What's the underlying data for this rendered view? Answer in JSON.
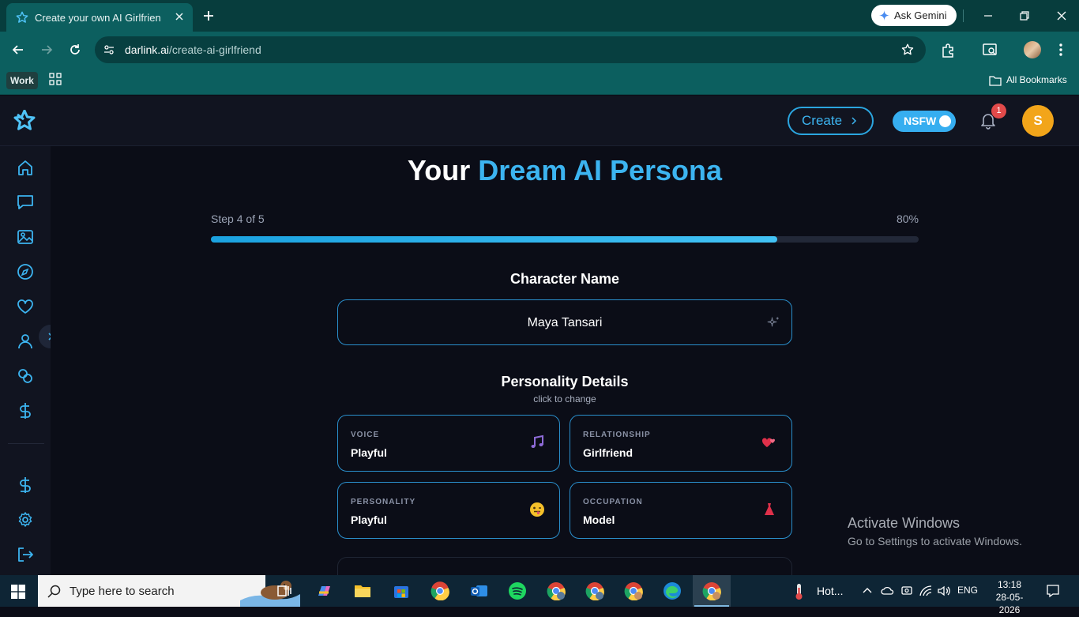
{
  "browser": {
    "tab_title": "Create your own AI Girlfriend | D",
    "gemini_label": "Ask Gemini",
    "url_domain": "darlink.ai",
    "url_path": "/create-ai-girlfriend",
    "bookmark_work": "Work",
    "all_bookmarks": "All Bookmarks"
  },
  "header": {
    "create_label": "Create",
    "nsfw_label": "NSFW",
    "notification_count": "1",
    "avatar_initial": "S"
  },
  "hero": {
    "title_plain": "Your ",
    "title_accent": "Dream AI Persona"
  },
  "progress": {
    "step_label": "Step 4 of 5",
    "percent_label": "80%",
    "fraction": 0.8
  },
  "character": {
    "section_title": "Character Name",
    "name": "Maya Tansari"
  },
  "personality": {
    "section_title": "Personality Details",
    "subtitle": "click to change",
    "cards": [
      {
        "key": "VOICE",
        "value": "Playful",
        "emoji": "🎵"
      },
      {
        "key": "RELATIONSHIP",
        "value": "Girlfriend",
        "emoji": "💞"
      },
      {
        "key": "PERSONALITY",
        "value": "Playful",
        "emoji": "😜"
      },
      {
        "key": "OCCUPATION",
        "value": "Model",
        "emoji": "👗"
      }
    ]
  },
  "watermark": {
    "line1": "Activate Windows",
    "line2": "Go to Settings to activate Windows."
  },
  "taskbar": {
    "search_placeholder": "Type here to search",
    "weather": "Hot...",
    "lang": "ENG",
    "time": "13:18",
    "date": "28-05-2026"
  },
  "colors": {
    "accent": "#3cb4f0",
    "badge": "#e24a4a",
    "avatar": "#f2a51a",
    "chrome": "#0c5f5f"
  }
}
